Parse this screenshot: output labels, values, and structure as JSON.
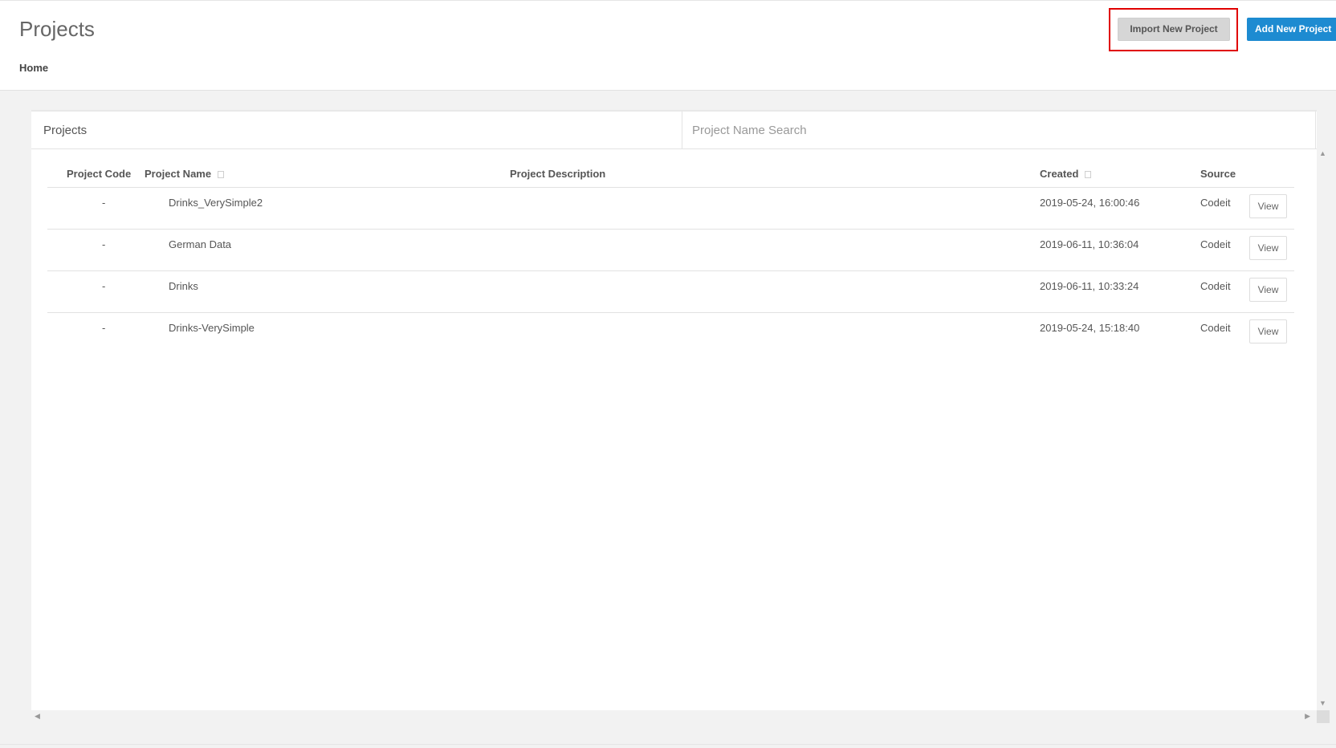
{
  "header": {
    "title": "Projects",
    "breadcrumb": "Home",
    "import_button": "Import New Project",
    "add_button": "Add New Project"
  },
  "panel": {
    "title": "Projects",
    "search_placeholder": "Project Name Search"
  },
  "table": {
    "columns": {
      "code": "Project Code",
      "name": "Project Name",
      "description": "Project Description",
      "created": "Created",
      "source": "Source"
    },
    "rows": [
      {
        "code": "-",
        "name": "Drinks_VerySimple2",
        "description": "",
        "created": "2019-05-24, 16:00:46",
        "source": "Codeit",
        "action": "View"
      },
      {
        "code": "-",
        "name": "German Data",
        "description": "",
        "created": "2019-06-11, 10:36:04",
        "source": "Codeit",
        "action": "View"
      },
      {
        "code": "-",
        "name": "Drinks",
        "description": "",
        "created": "2019-06-11, 10:33:24",
        "source": "Codeit",
        "action": "View"
      },
      {
        "code": "-",
        "name": "Drinks-VerySimple",
        "description": "",
        "created": "2019-05-24, 15:18:40",
        "source": "Codeit",
        "action": "View"
      }
    ]
  },
  "colors": {
    "primary_button": "#1d8bd1",
    "highlight": "#e00000",
    "secondary_button": "#d6d6d6"
  }
}
